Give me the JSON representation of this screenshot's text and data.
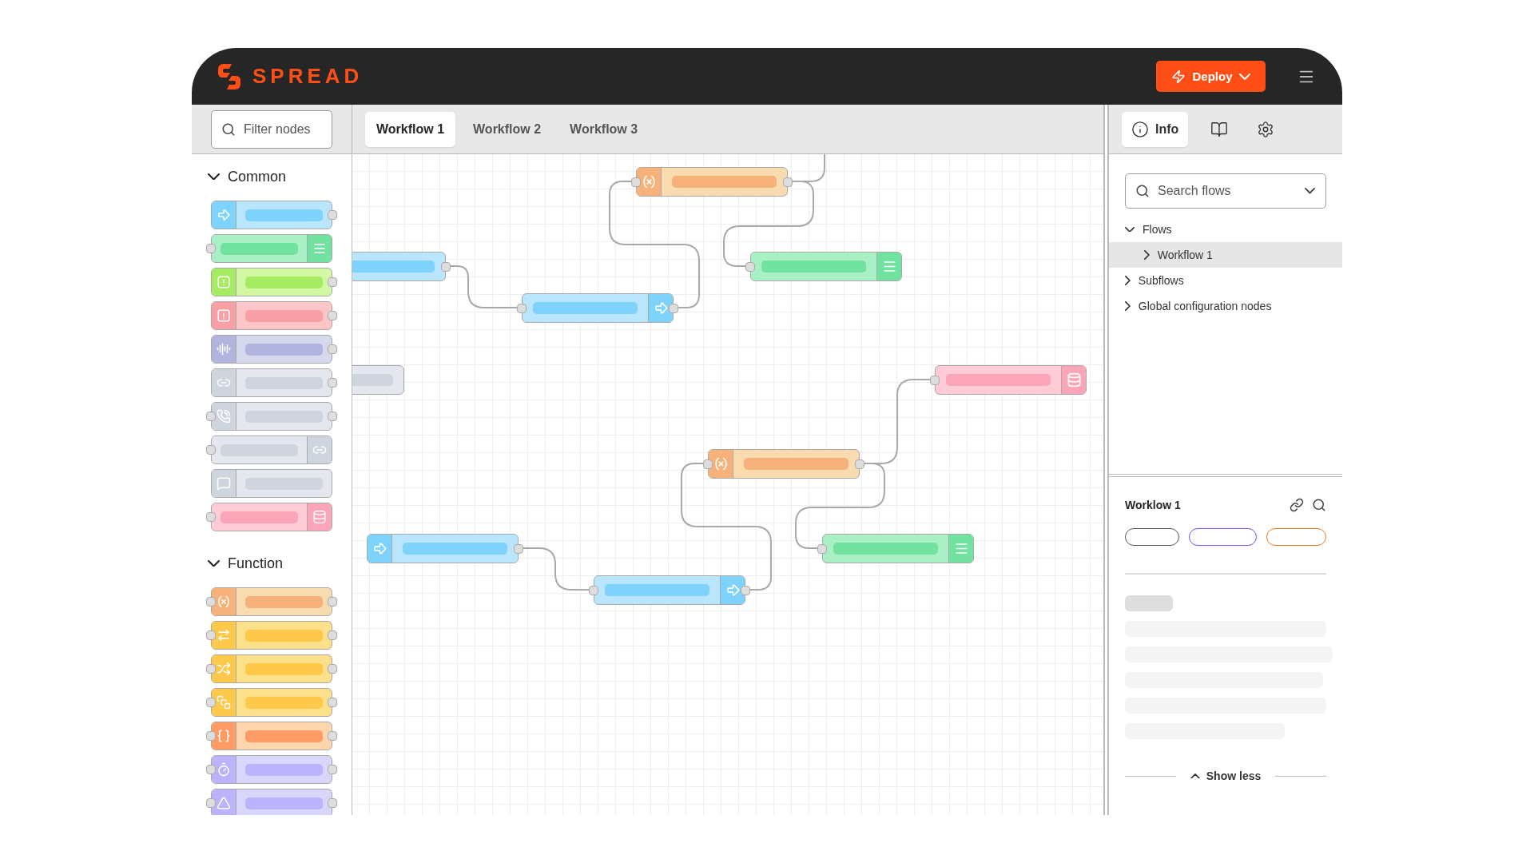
{
  "logo": {
    "text": "SPREAD"
  },
  "header": {
    "deploy_button": "Deploy"
  },
  "palette": {
    "filter": {
      "placeholder": "Filter nodes"
    },
    "sections": [
      {
        "title": "Common",
        "expanded": true,
        "nodes": [
          {
            "kind": "inject"
          },
          {
            "kind": "debug"
          },
          {
            "kind": "complete"
          },
          {
            "kind": "catch"
          },
          {
            "kind": "status"
          },
          {
            "kind": "linkin"
          },
          {
            "kind": "linkcall"
          },
          {
            "kind": "linkout"
          },
          {
            "kind": "comment"
          },
          {
            "kind": "database"
          }
        ]
      },
      {
        "title": "Function",
        "expanded": true,
        "nodes": [
          {
            "kind": "function"
          },
          {
            "kind": "change"
          },
          {
            "kind": "switch"
          },
          {
            "kind": "template"
          },
          {
            "kind": "json"
          },
          {
            "kind": "delay"
          },
          {
            "kind": "trigger"
          }
        ]
      }
    ]
  },
  "tabs": [
    {
      "label": "Workflow 1",
      "selected": true
    },
    {
      "label": "Workflow 2",
      "selected": false
    },
    {
      "label": "Workflow 3",
      "selected": false
    }
  ],
  "canvas": {
    "nodes": [
      {
        "kind": "function"
      },
      {
        "kind": "debug"
      },
      {
        "kind": "inject"
      },
      {
        "kind": "comment"
      },
      {
        "kind": "send"
      },
      {
        "kind": "database"
      },
      {
        "kind": "function"
      },
      {
        "kind": "debug"
      },
      {
        "kind": "inject"
      },
      {
        "kind": "send"
      }
    ]
  },
  "sidebar": {
    "tabs": [
      {
        "kind": "info",
        "label": "Info",
        "selected": true
      },
      {
        "kind": "help",
        "selected": false
      },
      {
        "kind": "settings",
        "selected": false
      }
    ],
    "search": {
      "placeholder": "Search flows"
    },
    "tree": [
      {
        "label": "Flows",
        "expanded": true,
        "selected": false,
        "children": [
          {
            "label": "Workflow 1",
            "expanded": false,
            "selected": true
          }
        ]
      },
      {
        "label": "Subflows",
        "expanded": false,
        "selected": false
      },
      {
        "label": "Global configuration nodes",
        "expanded": false,
        "selected": false
      }
    ],
    "details": {
      "title": "Worklow 1",
      "pills": [
        {
          "color": "#555555"
        },
        {
          "color": "#7c4dff"
        },
        {
          "color": "#e8791e"
        }
      ],
      "show_less": "Show less"
    }
  }
}
